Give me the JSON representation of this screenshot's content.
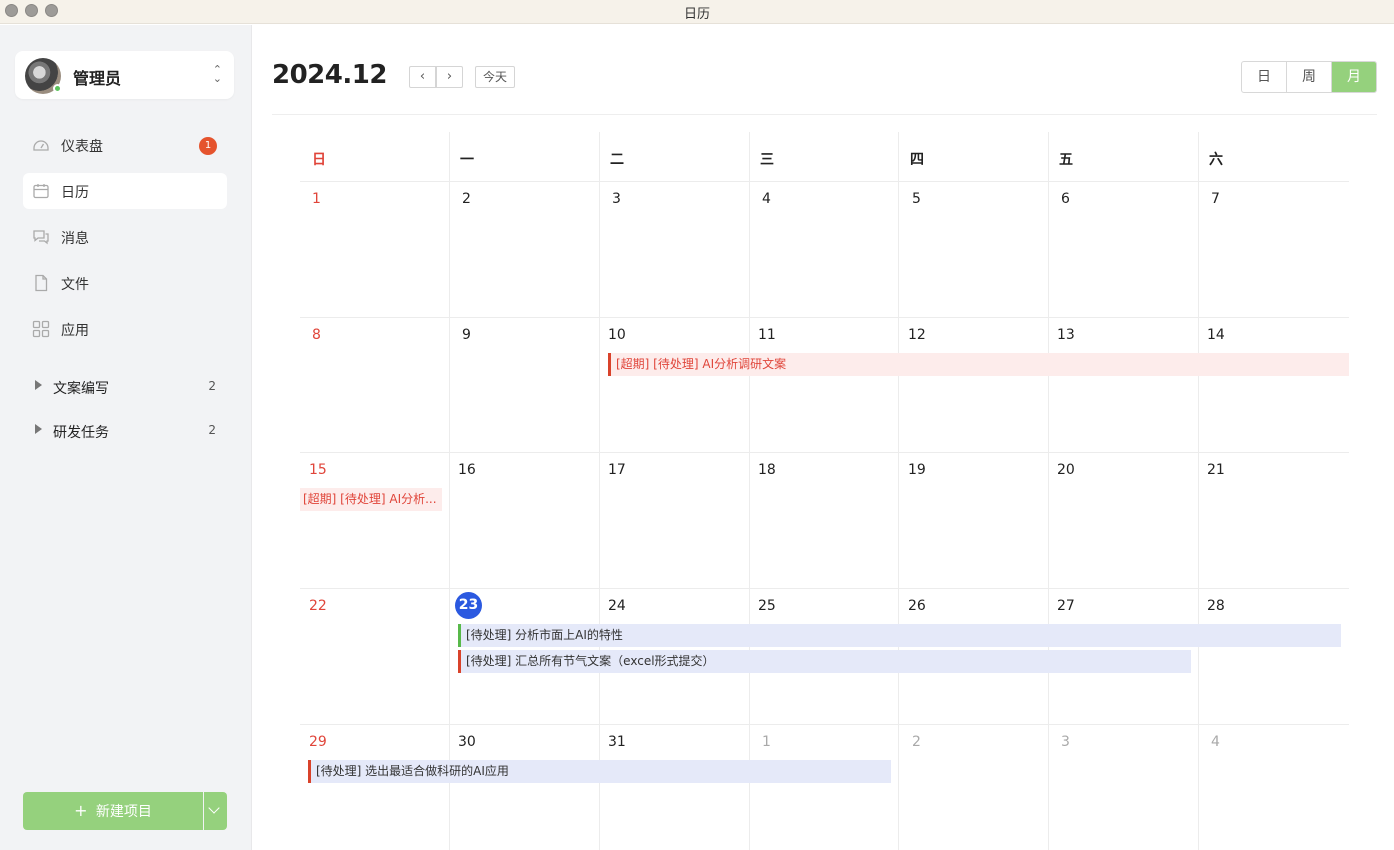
{
  "window": {
    "title": "日历"
  },
  "sidebar": {
    "user": {
      "name": "管理员"
    },
    "nav": [
      {
        "label": "仪表盘",
        "badge": "1"
      },
      {
        "label": "日历"
      },
      {
        "label": "消息"
      },
      {
        "label": "文件"
      },
      {
        "label": "应用"
      }
    ],
    "groups": [
      {
        "label": "文案编写",
        "count": "2"
      },
      {
        "label": "研发任务",
        "count": "2"
      }
    ],
    "new_project": {
      "plus": "+",
      "label": "新建项目"
    }
  },
  "header": {
    "month": "2024.12",
    "prev": "‹",
    "next": "›",
    "today": "今天",
    "views": [
      "日",
      "周",
      "月"
    ],
    "active_view": "月"
  },
  "calendar": {
    "weekdays": [
      "日",
      "一",
      "二",
      "三",
      "四",
      "五",
      "六"
    ],
    "weeks": [
      [
        "1",
        "2",
        "3",
        "4",
        "5",
        "6",
        "7"
      ],
      [
        "8",
        "9",
        "10",
        "11",
        "12",
        "13",
        "14"
      ],
      [
        "15",
        "16",
        "17",
        "18",
        "19",
        "20",
        "21"
      ],
      [
        "22",
        "23",
        "24",
        "25",
        "26",
        "27",
        "28"
      ],
      [
        "29",
        "30",
        "31",
        "1",
        "2",
        "3",
        "4"
      ]
    ],
    "today": "23",
    "events": {
      "week2_overdue": "[超期] [待处理] AI分析调研文案",
      "week3_overdue": "[超期] [待处理] AI分析...",
      "week4_a": "[待处理] 分析市面上AI的特性",
      "week4_b": "[待处理] 汇总所有节气文案（excel形式提交）",
      "week5": "[待处理] 选出最适合做科研的AI应用"
    }
  },
  "colors": {
    "accent_green": "#95d17d",
    "sunday_red": "#e0453a",
    "today_blue": "#2b59e0",
    "badge_red": "#e5532d"
  }
}
